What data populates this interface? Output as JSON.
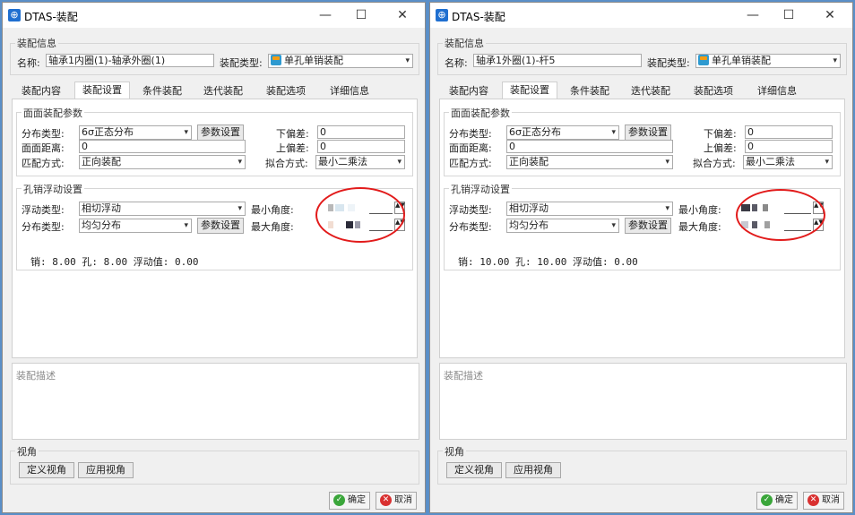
{
  "windows": [
    {
      "title": "DTAS-装配",
      "app_icon_glyph": "⊕",
      "titlebar_buttons": {
        "minimize": "—",
        "maximize": "☐",
        "close": "✕"
      },
      "info_group": "装配信息",
      "name_label": "名称:",
      "name_value": "轴承1内圈(1)-轴承外圈(1)",
      "type_label": "装配类型:",
      "type_value": "单孔单销装配",
      "tabs": [
        "装配内容",
        "装配设置",
        "条件装配",
        "迭代装配",
        "装配选项",
        "详细信息"
      ],
      "active_tab": 1,
      "surface_group": "面面装配参数",
      "dist_type_label": "分布类型:",
      "dist_type_value": "6σ正态分布",
      "param_button": "参数设置",
      "lower_dev_label": "下偏差:",
      "lower_dev_value": "0",
      "face_dist_label": "面面距离:",
      "face_dist_value": "0",
      "upper_dev_label": "上偏差:",
      "upper_dev_value": "0",
      "match_label": "匹配方式:",
      "match_value": "正向装配",
      "fit_label": "拟合方式:",
      "fit_value": "最小二乘法",
      "pin_group": "孔销浮动设置",
      "float_type_label": "浮动类型:",
      "float_type_value": "相切浮动",
      "min_angle_label": "最小角度:",
      "pin_dist_label": "分布类型:",
      "pin_dist_value": "均匀分布",
      "pin_param_button": "参数设置",
      "max_angle_label": "最大角度:",
      "summary": "销: 8.00 孔: 8.00 浮动值: 0.00",
      "desc_placeholder": "装配描述",
      "view_group": "视角",
      "define_view": "定义视角",
      "apply_view": "应用视角",
      "ok": "确定",
      "cancel": "取消"
    },
    {
      "title": "DTAS-装配",
      "app_icon_glyph": "⊕",
      "titlebar_buttons": {
        "minimize": "—",
        "maximize": "☐",
        "close": "✕"
      },
      "info_group": "装配信息",
      "name_label": "名称:",
      "name_value": "轴承1外圈(1)-杆5",
      "type_label": "装配类型:",
      "type_value": "单孔单销装配",
      "tabs": [
        "装配内容",
        "装配设置",
        "条件装配",
        "迭代装配",
        "装配选项",
        "详细信息"
      ],
      "active_tab": 1,
      "surface_group": "面面装配参数",
      "dist_type_label": "分布类型:",
      "dist_type_value": "6σ正态分布",
      "param_button": "参数设置",
      "lower_dev_label": "下偏差:",
      "lower_dev_value": "0",
      "face_dist_label": "面面距离:",
      "face_dist_value": "0",
      "upper_dev_label": "上偏差:",
      "upper_dev_value": "0",
      "match_label": "匹配方式:",
      "match_value": "正向装配",
      "fit_label": "拟合方式:",
      "fit_value": "最小二乘法",
      "pin_group": "孔销浮动设置",
      "float_type_label": "浮动类型:",
      "float_type_value": "相切浮动",
      "min_angle_label": "最小角度:",
      "pin_dist_label": "分布类型:",
      "pin_dist_value": "均匀分布",
      "pin_param_button": "参数设置",
      "max_angle_label": "最大角度:",
      "summary": "销: 10.00 孔: 10.00 浮动值: 0.00",
      "desc_placeholder": "装配描述",
      "view_group": "视角",
      "define_view": "定义视角",
      "apply_view": "应用视角",
      "ok": "确定",
      "cancel": "取消"
    }
  ],
  "colors": {
    "annotation_ring": "#e21b1b",
    "accent": "#1f6fd0"
  },
  "icons": {
    "app": "dtas-logo-icon",
    "assembly_type": "assembly-type-icon",
    "ok": "check-icon",
    "cancel": "close-circle-icon"
  }
}
